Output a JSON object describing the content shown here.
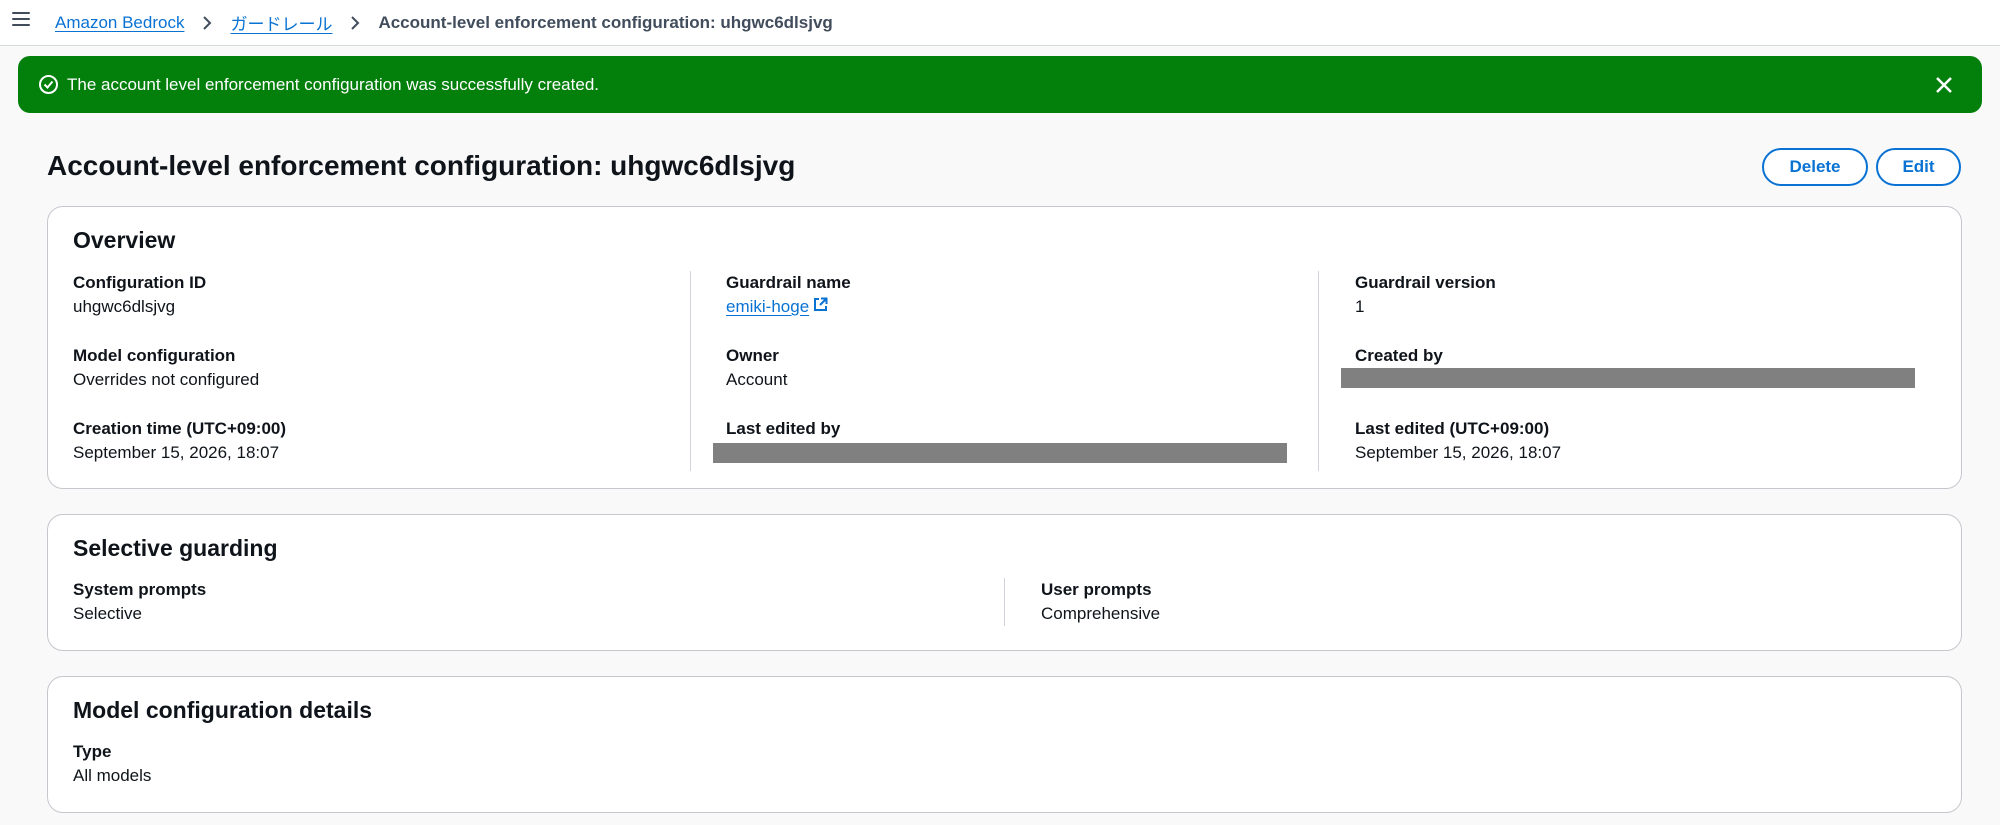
{
  "breadcrumb": {
    "items": [
      "Amazon Bedrock",
      "ガードレール"
    ],
    "current": "Account-level enforcement configuration: uhgwc6dlsjvg"
  },
  "flash": {
    "message": "The account level enforcement configuration was successfully created.",
    "type": "success",
    "color": "#037f0c"
  },
  "header": {
    "title": "Account-level enforcement configuration: uhgwc6dlsjvg",
    "delete_label": "Delete",
    "edit_label": "Edit"
  },
  "overview": {
    "title": "Overview",
    "fields": {
      "configuration_id": {
        "label": "Configuration ID",
        "value": "uhgwc6dlsjvg"
      },
      "guardrail_name": {
        "label": "Guardrail name",
        "value": "emiki-hoge"
      },
      "guardrail_version": {
        "label": "Guardrail version",
        "value": "1"
      },
      "model_configuration": {
        "label": "Model configuration",
        "value": "Overrides not configured"
      },
      "owner": {
        "label": "Owner",
        "value": "Account"
      },
      "created_by": {
        "label": "Created by",
        "value": ""
      },
      "creation_time": {
        "label": "Creation time (UTC+09:00)",
        "value": "September 15, 2026, 18:07"
      },
      "last_edited_by": {
        "label": "Last edited by",
        "value": ""
      },
      "last_edited": {
        "label": "Last edited (UTC+09:00)",
        "value": "September 15, 2026, 18:07"
      }
    }
  },
  "selective_guarding": {
    "title": "Selective guarding",
    "system_prompts": {
      "label": "System prompts",
      "value": "Selective"
    },
    "user_prompts": {
      "label": "User prompts",
      "value": "Comprehensive"
    }
  },
  "model_configuration_details": {
    "title": "Model configuration details",
    "type": {
      "label": "Type",
      "value": "All models"
    }
  },
  "colors": {
    "link": "#0972d3",
    "success": "#037f0c",
    "redacted": "#808080"
  }
}
